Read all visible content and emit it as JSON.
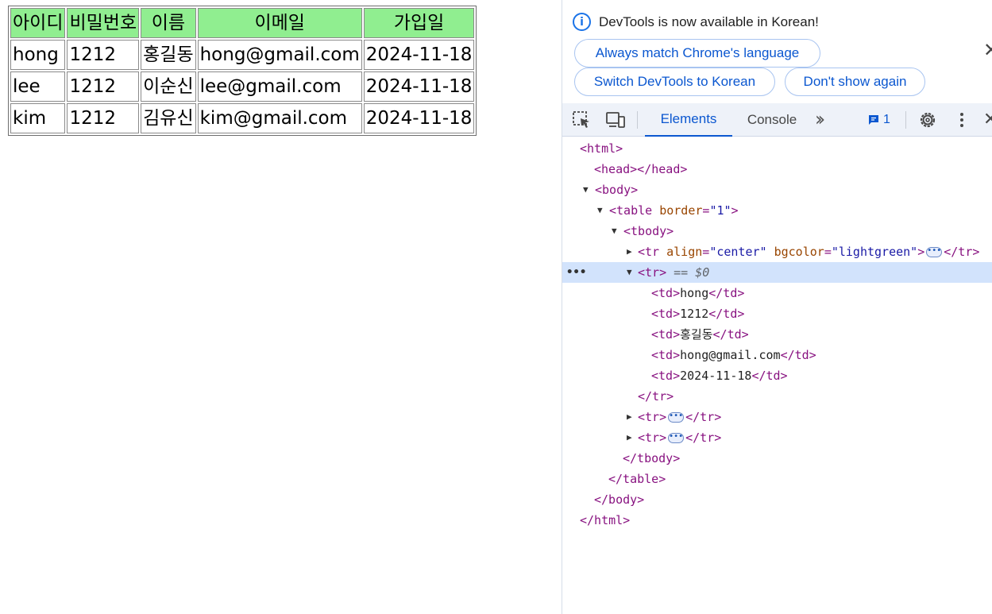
{
  "page": {
    "table": {
      "header": [
        "아이디",
        "비밀번호",
        "이름",
        "이메일",
        "가입일"
      ],
      "header_bgcolor": "#90ee90",
      "rows": [
        [
          "hong",
          "1212",
          "홍길동",
          "hong@gmail.com",
          "2024-11-18"
        ],
        [
          "lee",
          "1212",
          "이순신",
          "lee@gmail.com",
          "2024-11-18"
        ],
        [
          "kim",
          "1212",
          "김유신",
          "kim@gmail.com",
          "2024-11-18"
        ]
      ]
    }
  },
  "devtools": {
    "infobar": {
      "message": "DevTools is now available in Korean!",
      "always_match_label": "Always match Chrome's language",
      "switch_label": "Switch DevTools to Korean",
      "dont_show_label": "Don't show again",
      "close_icon": "close-icon"
    },
    "toolbar": {
      "inspect_icon": "inspect-element-icon",
      "device_icon": "device-toolbar-icon",
      "tabs": [
        "Elements",
        "Console"
      ],
      "active_tab": "Elements",
      "more_tabs_icon": "more-tabs-chevron-icon",
      "issues_count": "1",
      "settings_icon": "gear-icon",
      "menu_icon": "kebab-menu-icon"
    },
    "dom_tree": {
      "html_open": "<html>",
      "head": "<head></head>",
      "body_open": "<body>",
      "table_tag": "<table",
      "table_attr_name": "border",
      "table_attr_val": "\"1\"",
      "tbody_open": "<tbody>",
      "tr_head_attr1_name": "align",
      "tr_head_attr1_val": "\"center\"",
      "tr_head_attr2_name": "bgcolor",
      "tr_head_attr2_val": "\"lightgreen\"",
      "tr_open": "<tr>",
      "tr_close": "</tr>",
      "selected_marker": "== $0",
      "td_open": "<td>",
      "td_close": "</td>",
      "td_values": [
        "hong",
        "1212",
        "홍길동",
        "hong@gmail.com",
        "2024-11-18"
      ],
      "tbody_close": "</tbody>",
      "table_close": "</table>",
      "body_close": "</body>",
      "html_close": "</html>"
    }
  }
}
